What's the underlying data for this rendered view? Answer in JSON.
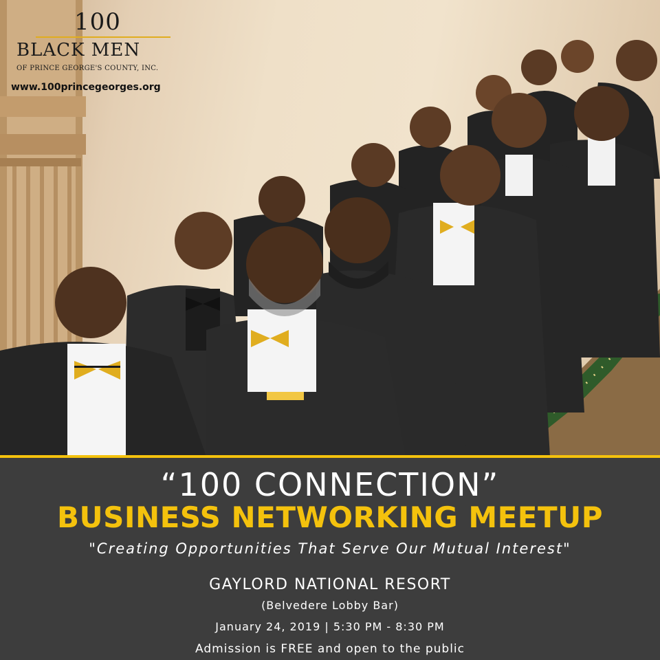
{
  "logo": {
    "number": "100",
    "name": "BLACK MEN",
    "subtitle": "OF PRINCE GEORGE'S COUNTY, INC.",
    "url": "www.100princegeorges.org"
  },
  "event": {
    "title": "“100 CONNECTION”",
    "subtitle": "BUSINESS NETWORKING MEETUP",
    "tagline": "\"Creating Opportunities That Serve Our Mutual Interest\"",
    "venue": "GAYLORD NATIONAL RESORT",
    "room": "(Belvedere Lobby Bar)",
    "date_time": "January 24, 2019 | 5:30 PM - 8:30 PM",
    "admission": "Admission is FREE and open to the public"
  },
  "colors": {
    "accent_gold": "#f4c20d",
    "panel_background": "#3d3d3d",
    "suit": "#232323"
  }
}
